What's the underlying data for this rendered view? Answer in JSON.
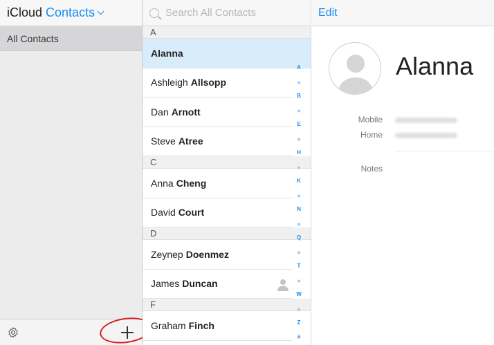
{
  "sidebar": {
    "brand": "iCloud",
    "app_title": "Contacts",
    "groups": [
      {
        "label": "All Contacts"
      }
    ]
  },
  "search": {
    "placeholder": "Search All Contacts"
  },
  "contacts": {
    "sections": [
      {
        "letter": "A",
        "entries": [
          {
            "first": "Alanna",
            "last": ""
          },
          {
            "first": "Ashleigh",
            "last": "Allsopp"
          },
          {
            "first": "Dan",
            "last": "Arnott"
          },
          {
            "first": "Steve",
            "last": "Atree"
          }
        ]
      },
      {
        "letter": "C",
        "entries": [
          {
            "first": "Anna",
            "last": "Cheng"
          },
          {
            "first": "David",
            "last": "Court"
          }
        ]
      },
      {
        "letter": "D",
        "entries": [
          {
            "first": "Zeynep",
            "last": "Doenmez"
          },
          {
            "first": "James",
            "last": "Duncan"
          }
        ]
      },
      {
        "letter": "F",
        "entries": [
          {
            "first": "Graham",
            "last": "Finch"
          }
        ]
      }
    ],
    "index": [
      "A",
      "•",
      "B",
      "•",
      "E",
      "•",
      "H",
      "•",
      "K",
      "•",
      "N",
      "•",
      "Q",
      "•",
      "T",
      "•",
      "W",
      "•",
      "Z",
      "#"
    ]
  },
  "detail": {
    "edit_label": "Edit",
    "name": "Alanna",
    "mobile_label": "Mobile",
    "home_label": "Home",
    "notes_label": "Notes"
  },
  "colors": {
    "accent": "#1a8cf0",
    "selected_row": "#d9ecfa",
    "annotation": "#d32020"
  }
}
